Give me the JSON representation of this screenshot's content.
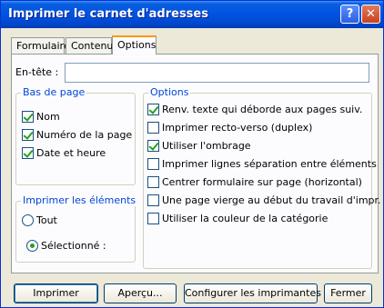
{
  "window": {
    "title": "Imprimer le carnet d'adresses",
    "help_glyph": "?",
    "close_glyph": "✕"
  },
  "tabs": [
    {
      "label": "Formulaire"
    },
    {
      "label": "Contenu"
    },
    {
      "label": "Options",
      "active": true
    }
  ],
  "header": {
    "label": "En-tête :",
    "value": ""
  },
  "footer_group": {
    "title": "Bas de page",
    "items": [
      {
        "label": "Nom",
        "checked": true
      },
      {
        "label": "Numéro de la page",
        "checked": true
      },
      {
        "label": "Date et heure",
        "checked": true
      }
    ]
  },
  "print_group": {
    "title": "Imprimer les éléments",
    "options": [
      {
        "label": "Tout",
        "selected": false
      },
      {
        "label": "Sélectionné :",
        "selected": true
      }
    ]
  },
  "options_group": {
    "title": "Options",
    "items": [
      {
        "label": "Renv. texte qui déborde aux pages suiv.",
        "checked": true
      },
      {
        "label": "Imprimer recto-verso (duplex)",
        "checked": false
      },
      {
        "label": "Utiliser l'ombrage",
        "checked": true
      },
      {
        "label": "Imprimer lignes séparation entre éléments",
        "checked": false
      },
      {
        "label": "Centrer formulaire sur page (horizontal)",
        "checked": false
      },
      {
        "label": "Une page vierge au début du travail d'impr.",
        "checked": false
      },
      {
        "label": "Utiliser la couleur de la catégorie",
        "checked": false
      }
    ]
  },
  "buttons": {
    "print": "Imprimer",
    "preview": "Aperçu...",
    "configure": "Configurer les imprimantes",
    "close": "Fermer"
  },
  "colors": {
    "title_bar": "#0054e3",
    "group_title": "#0046d5",
    "active_tab_accent": "#ff9900",
    "check_mark": "#21a121"
  }
}
